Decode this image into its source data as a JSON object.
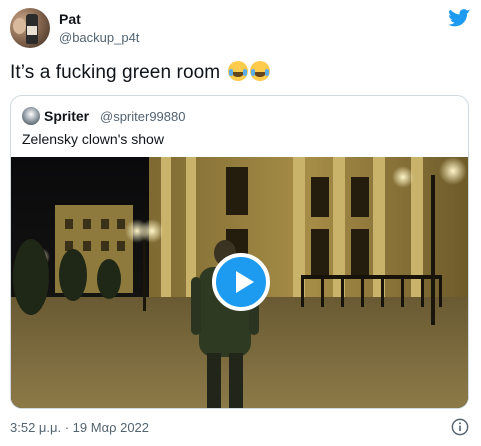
{
  "tweet": {
    "user_name": "Pat",
    "user_handle": "@backup_p4t",
    "text": "It’s a fucking green room",
    "emojis": [
      "face-with-tears-of-joy-icon",
      "face-with-tears-of-joy-icon"
    ],
    "timestamp": "3:52 μ.μ. · 19 Μαρ 2022"
  },
  "quoted": {
    "user_name": "Spriter",
    "user_handle": "@spriter99880",
    "text": "Zelensky clown's show"
  },
  "colors": {
    "brand": "#1d9bf0",
    "text_primary": "#0f1419",
    "text_secondary": "#536471",
    "border": "#cfd9de"
  },
  "icons": {
    "logo": "twitter-bird-icon",
    "play": "play-icon",
    "info": "info-icon"
  }
}
